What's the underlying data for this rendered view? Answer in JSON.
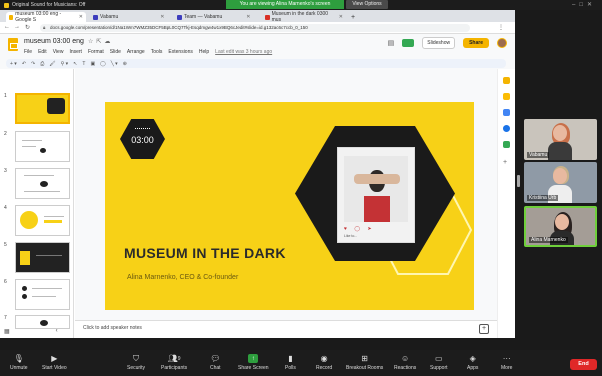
{
  "zoom": {
    "original_sound": "Original Sound for Musicians: Off",
    "share_banner": "You are viewing Alina Marnenko's screen",
    "view_options": "View Options",
    "toolbar": [
      {
        "label": "Unmute",
        "icon": "mic-off-icon"
      },
      {
        "label": "Start Video",
        "icon": "video-off-icon"
      },
      {
        "label": "Security",
        "icon": "shield-icon"
      },
      {
        "label": "Participants",
        "icon": "participants-icon",
        "count": "9"
      },
      {
        "label": "Chat",
        "icon": "chat-icon"
      },
      {
        "label": "Share Screen",
        "icon": "share-screen-icon"
      },
      {
        "label": "Polls",
        "icon": "polls-icon"
      },
      {
        "label": "Record",
        "icon": "record-icon"
      },
      {
        "label": "Breakout Rooms",
        "icon": "breakout-icon"
      },
      {
        "label": "Reactions",
        "icon": "reactions-icon"
      },
      {
        "label": "Support",
        "icon": "support-icon"
      },
      {
        "label": "Apps",
        "icon": "apps-icon"
      },
      {
        "label": "More",
        "icon": "more-icon"
      }
    ],
    "end_label": "End",
    "participants": [
      {
        "name": "Vabamu"
      },
      {
        "name": "Kristiina Urb"
      },
      {
        "name": "Alina Marnenko"
      }
    ]
  },
  "browser": {
    "tabs": [
      {
        "label": "museum 03:00 eng - Google S",
        "color": "#f4b400"
      },
      {
        "label": "Vabamu",
        "color": "#3d3dbd"
      },
      {
        "label": "Team — Vabamu",
        "color": "#3d3dbd"
      },
      {
        "label": "Museum in the dark 0300 mus",
        "color": "#d93025"
      }
    ],
    "url": "docs.google.com/presentation/d/1Na1Wm7WMZ35DCF5BpL0CQ7Tkj-Esqdmgw4w1x9BQ6cJedit#slide=id.g132ac6c7ccb_0_150"
  },
  "slides": {
    "doc_title": "museum 03:00 eng",
    "menu": [
      "File",
      "Edit",
      "View",
      "Insert",
      "Format",
      "Slide",
      "Arrange",
      "Tools",
      "Extensions",
      "Help"
    ],
    "last_edit": "Last edit was 3 hours ago",
    "slideshow_label": "Slideshow",
    "share_label": "Share",
    "notes_placeholder": "Click to add speaker notes",
    "thumbnail_numbers": [
      "1",
      "2",
      "3",
      "4",
      "5",
      "6",
      "7"
    ],
    "current_slide": {
      "time": "03:00",
      "title": "MUSEUM IN THE DARK",
      "subtitle": "Alina Marnenko, CEO & Co-founder",
      "photo_caption": "Like to..."
    }
  }
}
